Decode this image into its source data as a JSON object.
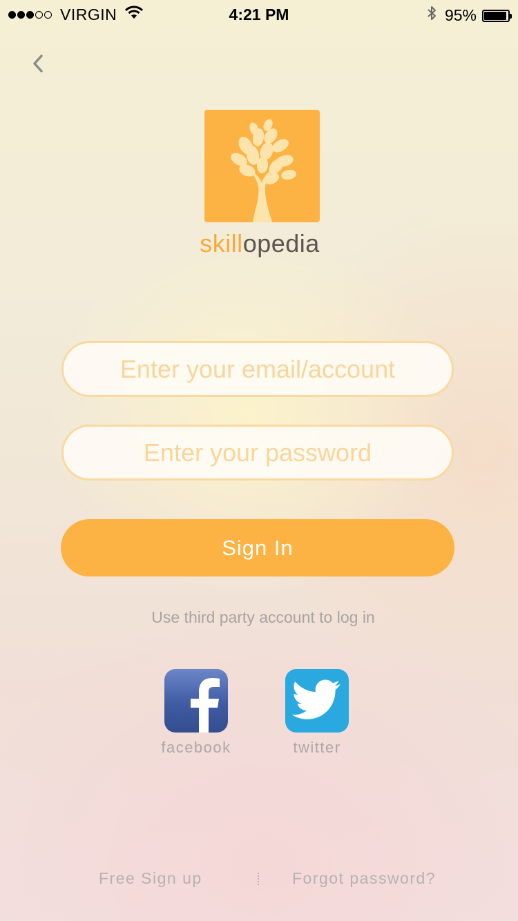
{
  "status_bar": {
    "carrier": "VIRGIN",
    "time": "4:21 PM",
    "battery_percent": "95%",
    "signal_bars_filled": 3,
    "signal_bars_total": 5
  },
  "brand": {
    "name_part1": "skill",
    "name_part2": "opedia",
    "logo_color": "#fdb244",
    "logo_icon": "tree-icon"
  },
  "login": {
    "email_placeholder": "Enter your email/account",
    "password_placeholder": "Enter your password",
    "signin_label": "Sign In"
  },
  "third_party": {
    "prompt": "Use third party account to log in",
    "providers": [
      {
        "label": "facebook",
        "icon": "facebook-icon",
        "color": "#3f5ba2"
      },
      {
        "label": "twitter",
        "icon": "twitter-icon",
        "color": "#2aa9e0"
      }
    ]
  },
  "footer": {
    "signup_label": "Free Sign up",
    "forgot_label": "Forgot password?"
  },
  "colors": {
    "accent": "#fdb244",
    "muted_text": "#a8a4a2"
  }
}
